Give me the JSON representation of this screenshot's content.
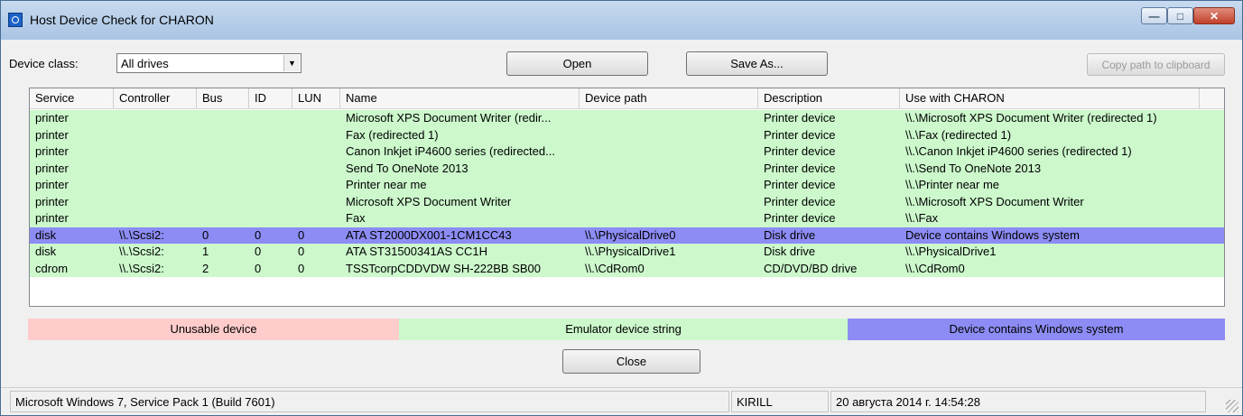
{
  "window": {
    "title": "Host Device Check for CHARON",
    "controls": {
      "minimize": "—",
      "maximize": "□",
      "close": "✕"
    }
  },
  "toolbar": {
    "device_class_label": "Device class:",
    "device_class_value": "All drives",
    "open_label": "Open",
    "save_as_label": "Save As...",
    "copy_path_label": "Copy path to clipboard"
  },
  "table": {
    "columns": [
      "Service",
      "Controller",
      "Bus",
      "ID",
      "LUN",
      "Name",
      "Device path",
      "Description",
      "Use with CHARON"
    ],
    "rows": [
      {
        "service": "printer",
        "controller": "",
        "bus": "",
        "id": "",
        "lun": "",
        "name": "Microsoft XPS Document Writer (redir...",
        "path": "",
        "description": "Printer device",
        "use": "\\\\.\\Microsoft XPS Document Writer (redirected 1)",
        "status": "emulator"
      },
      {
        "service": "printer",
        "controller": "",
        "bus": "",
        "id": "",
        "lun": "",
        "name": "Fax (redirected 1)",
        "path": "",
        "description": "Printer device",
        "use": "\\\\.\\Fax (redirected 1)",
        "status": "emulator"
      },
      {
        "service": "printer",
        "controller": "",
        "bus": "",
        "id": "",
        "lun": "",
        "name": "Canon Inkjet iP4600 series (redirected...",
        "path": "",
        "description": "Printer device",
        "use": "\\\\.\\Canon Inkjet iP4600 series (redirected 1)",
        "status": "emulator"
      },
      {
        "service": "printer",
        "controller": "",
        "bus": "",
        "id": "",
        "lun": "",
        "name": "Send To OneNote 2013",
        "path": "",
        "description": "Printer device",
        "use": "\\\\.\\Send To OneNote 2013",
        "status": "emulator"
      },
      {
        "service": "printer",
        "controller": "",
        "bus": "",
        "id": "",
        "lun": "",
        "name": "Printer near me",
        "path": "",
        "description": "Printer device",
        "use": "\\\\.\\Printer near me",
        "status": "emulator"
      },
      {
        "service": "printer",
        "controller": "",
        "bus": "",
        "id": "",
        "lun": "",
        "name": "Microsoft XPS Document Writer",
        "path": "",
        "description": "Printer device",
        "use": "\\\\.\\Microsoft XPS Document Writer",
        "status": "emulator"
      },
      {
        "service": "printer",
        "controller": "",
        "bus": "",
        "id": "",
        "lun": "",
        "name": "Fax",
        "path": "",
        "description": "Printer device",
        "use": "\\\\.\\Fax",
        "status": "emulator"
      },
      {
        "service": "disk",
        "controller": "\\\\.\\Scsi2:",
        "bus": "0",
        "id": "0",
        "lun": "0",
        "name": "ATA ST2000DX001-1CM1CC43",
        "path": "\\\\.\\PhysicalDrive0",
        "description": "Disk drive",
        "use": "Device contains Windows system",
        "status": "windows"
      },
      {
        "service": "disk",
        "controller": "\\\\.\\Scsi2:",
        "bus": "1",
        "id": "0",
        "lun": "0",
        "name": "ATA ST31500341AS CC1H",
        "path": "\\\\.\\PhysicalDrive1",
        "description": "Disk drive",
        "use": "\\\\.\\PhysicalDrive1",
        "status": "emulator"
      },
      {
        "service": "cdrom",
        "controller": "\\\\.\\Scsi2:",
        "bus": "2",
        "id": "0",
        "lun": "0",
        "name": "TSSTcorpCDDVDW SH-222BB SB00",
        "path": "\\\\.\\CdRom0",
        "description": "CD/DVD/BD drive",
        "use": "\\\\.\\CdRom0",
        "status": "emulator"
      }
    ]
  },
  "legend": {
    "unusable": "Unusable device",
    "emulator": "Emulator device string",
    "windows": "Device contains Windows system"
  },
  "colors": {
    "unusable": "#ffcccc",
    "emulator": "#ccf8cc",
    "windows": "#8c8cf4"
  },
  "close_label": "Close",
  "statusbar": {
    "os": "Microsoft Windows 7, Service Pack 1 (Build 7601)",
    "user": "KIRILL",
    "datetime": "20 августа 2014 г. 14:54:28"
  }
}
